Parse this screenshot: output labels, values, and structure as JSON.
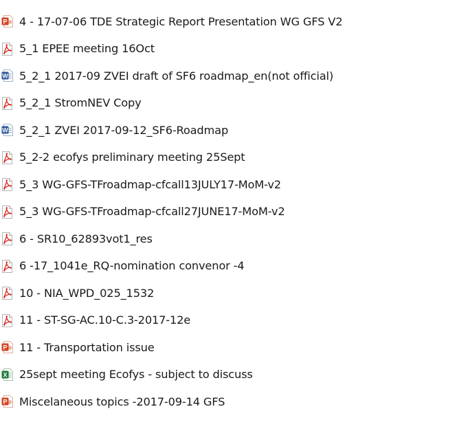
{
  "files": [
    {
      "name": "4 - 17-07-06 TDE Strategic Report Presentation WG GFS V2",
      "type": "powerpoint",
      "icon": "powerpoint-file-icon"
    },
    {
      "name": "5_1 EPEE meeting 16Oct",
      "type": "pdf",
      "icon": "pdf-file-icon"
    },
    {
      "name": "5_2_1 2017-09 ZVEI draft of SF6 roadmap_en(not official)",
      "type": "word",
      "icon": "word-file-icon"
    },
    {
      "name": "5_2_1 StromNEV Copy",
      "type": "pdf",
      "icon": "pdf-file-icon"
    },
    {
      "name": "5_2_1 ZVEI 2017-09-12_SF6-Roadmap",
      "type": "word",
      "icon": "word-file-icon"
    },
    {
      "name": "5_2-2 ecofys preliminary meeting 25Sept",
      "type": "pdf",
      "icon": "pdf-file-icon"
    },
    {
      "name": "5_3 WG-GFS-TFroadmap-cfcall13JULY17-MoM-v2",
      "type": "pdf",
      "icon": "pdf-file-icon"
    },
    {
      "name": "5_3 WG-GFS-TFroadmap-cfcall27JUNE17-MoM-v2",
      "type": "pdf",
      "icon": "pdf-file-icon"
    },
    {
      "name": "6 - SR10_62893vot1_res",
      "type": "pdf",
      "icon": "pdf-file-icon"
    },
    {
      "name": "6 -17_1041e_RQ-nomination convenor -4",
      "type": "pdf",
      "icon": "pdf-file-icon"
    },
    {
      "name": "10 - NIA_WPD_025_1532",
      "type": "pdf",
      "icon": "pdf-file-icon"
    },
    {
      "name": "11 - ST-SG-AC.10-C.3-2017-12e",
      "type": "pdf",
      "icon": "pdf-file-icon"
    },
    {
      "name": "11 - Transportation issue",
      "type": "powerpoint",
      "icon": "powerpoint-file-icon"
    },
    {
      "name": "25sept meeting Ecofys - subject to discuss",
      "type": "excel",
      "icon": "excel-file-icon"
    },
    {
      "name": "Miscelaneous topics -2017-09-14 GFS",
      "type": "powerpoint",
      "icon": "powerpoint-file-icon"
    }
  ],
  "colors": {
    "pdf": "#d9241b",
    "word": "#2b5797",
    "excel": "#1f7a3a",
    "powerpoint": "#d24726",
    "text": "#1a1a1a"
  }
}
